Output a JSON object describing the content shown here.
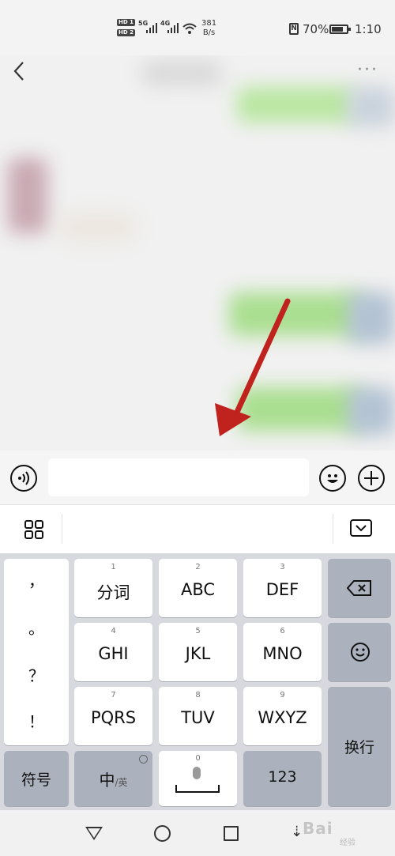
{
  "status_bar": {
    "net_speed_value": "381",
    "net_speed_unit": "B/s",
    "battery_percent": "70%",
    "battery_level": 0.7,
    "time": "1:10",
    "nfc_label": "N",
    "hd1": "HD 1",
    "hd2": "HD 2",
    "sig1": "5G",
    "sig2": "4G"
  },
  "chat_input": {
    "value": "",
    "placeholder": ""
  },
  "keyboard": {
    "punctuation": [
      "，",
      "。",
      "？",
      "！"
    ],
    "keys": [
      {
        "num": "1",
        "label": "分词"
      },
      {
        "num": "2",
        "label": "ABC"
      },
      {
        "num": "3",
        "label": "DEF"
      },
      {
        "num": "4",
        "label": "GHI"
      },
      {
        "num": "5",
        "label": "JKL"
      },
      {
        "num": "6",
        "label": "MNO"
      },
      {
        "num": "7",
        "label": "PQRS"
      },
      {
        "num": "8",
        "label": "TUV"
      },
      {
        "num": "9",
        "label": "WXYZ"
      }
    ],
    "symbols_label": "符号",
    "lang_main": "中",
    "lang_alt": "/英",
    "space_num": "0",
    "numbers_label": "123",
    "newline_label": "换行"
  },
  "watermark": {
    "text": "Bai",
    "sub": "经验"
  },
  "colors": {
    "arrow": "#c0221e",
    "keyboard_bg": "#d7d9df",
    "function_key": "#acb2bd"
  }
}
